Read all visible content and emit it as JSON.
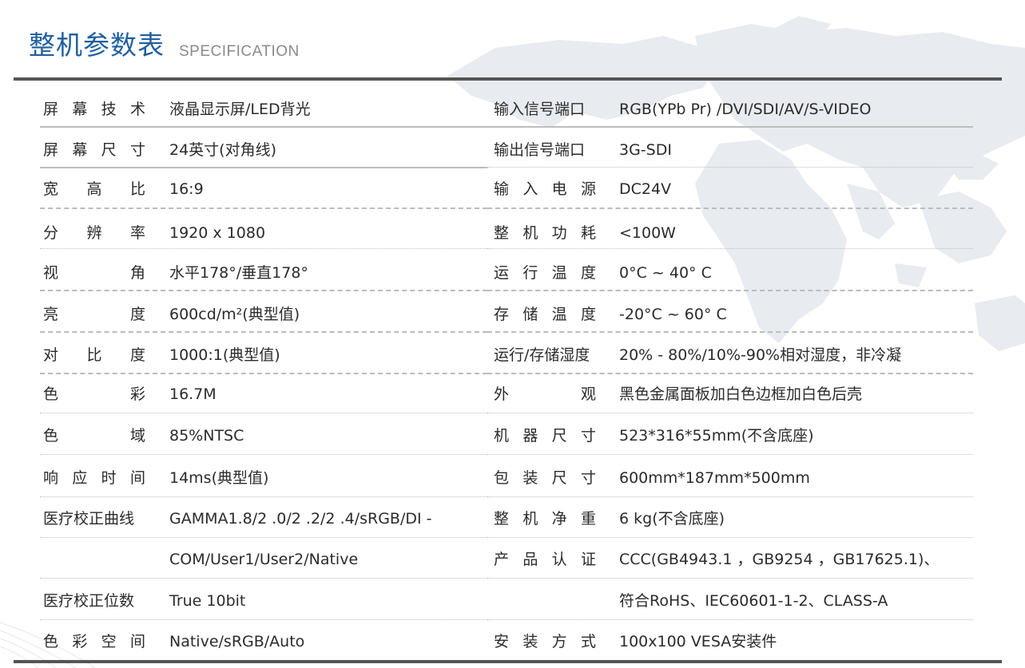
{
  "header": {
    "title": "整机参数表",
    "subtitle": "SPECIFICATION"
  },
  "rows": [
    {
      "l_label": [
        "屏",
        "幕",
        "技",
        "术"
      ],
      "l_value": "液晶显示屏/LED背光",
      "r_label": [
        "输入信号端口"
      ],
      "r_value": "RGB(YPb Pr) /DVI/SDI/AV/S-VIDEO"
    },
    {
      "l_label": [
        "屏",
        "幕",
        "尺",
        "寸"
      ],
      "l_value": "24英寸(对角线)",
      "r_label": [
        "输出信号端口"
      ],
      "r_value": "3G-SDI"
    },
    {
      "l_label": [
        "宽",
        "高",
        "比"
      ],
      "l_value": "16:9",
      "r_label": [
        "输",
        "入",
        "电",
        "源"
      ],
      "r_value": "DC24V"
    },
    {
      "l_label": [
        "分",
        "辨",
        "率"
      ],
      "l_value": "1920 x 1080",
      "r_label": [
        "整",
        "机",
        "功",
        "耗"
      ],
      "r_value": "<100W"
    },
    {
      "l_label": [
        "视",
        "角"
      ],
      "l_value": "水平178°/垂直178°",
      "r_label": [
        "运",
        "行",
        "温",
        "度"
      ],
      "r_value": "0°C ~ 40° C"
    },
    {
      "l_label": [
        "亮",
        "度"
      ],
      "l_value": "600cd/m²(典型值)",
      "r_label": [
        "存",
        "储",
        "温",
        "度"
      ],
      "r_value": "-20°C ~ 60° C"
    },
    {
      "l_label": [
        "对",
        "比",
        "度"
      ],
      "l_value": "1000:1(典型值)",
      "r_label": [
        "运行/存储湿度"
      ],
      "r_value": "20% - 80%/10%-90%相对湿度，非冷凝"
    },
    {
      "l_label": [
        "色",
        "彩"
      ],
      "l_value": "16.7M",
      "r_label": [
        "外",
        "观"
      ],
      "r_value": "黑色金属面板加白色边框加白色后壳"
    },
    {
      "l_label": [
        "色",
        "域"
      ],
      "l_value": "85%NTSC",
      "r_label": [
        "机",
        "器",
        "尺",
        "寸"
      ],
      "r_value": "523*316*55mm(不含底座)"
    },
    {
      "l_label": [
        "响",
        "应",
        "时",
        "间"
      ],
      "l_value": "14ms(典型值)",
      "r_label": [
        "包",
        "装",
        "尺",
        "寸"
      ],
      "r_value": "600mm*187mm*500mm"
    },
    {
      "l_label": [
        "医疗校正曲线"
      ],
      "l_value": "GAMMA1.8/2 .0/2 .2/2 .4/sRGB/DI -",
      "r_label": [
        "整",
        "机",
        "净",
        "重"
      ],
      "r_value": "6 kg(不含底座)"
    },
    {
      "l_label": [],
      "l_value": "COM/User1/User2/Native",
      "r_label": [
        "产",
        "品",
        "认",
        "证"
      ],
      "r_value": "CCC(GB4943.1 ，GB9254 ，GB17625.1)、"
    },
    {
      "l_label": [
        "医疗校正位数"
      ],
      "l_value": "True 10bit",
      "r_label": [],
      "r_value": "符合RoHS、IEC60601-1-2、CLASS-A"
    },
    {
      "l_label": [
        "色",
        "彩",
        "空",
        "间"
      ],
      "l_value": "Native/sRGB/Auto",
      "r_label": [
        "安",
        "装",
        "方",
        "式"
      ],
      "r_value": "100x100 VESA安装件"
    }
  ]
}
